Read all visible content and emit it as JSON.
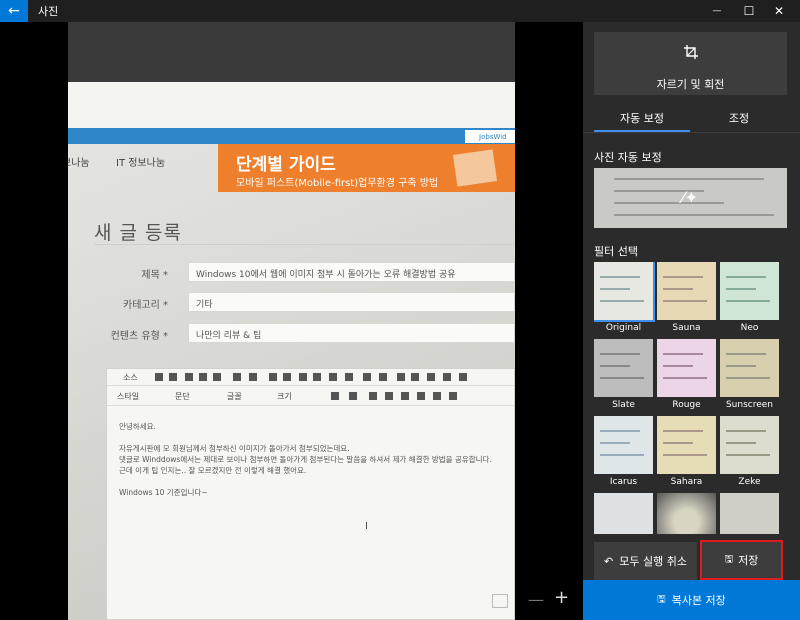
{
  "window": {
    "title": "사진",
    "back_icon": "←",
    "minimize_icon": "—",
    "maximize_icon": "☐",
    "close_icon": "✕"
  },
  "photo": {
    "nav_items": [
      "보나눔",
      "IT 정보나눔"
    ],
    "logo_text": "JobsWid",
    "banner_title": "단계별 가이드",
    "banner_subtitle": "모바일 퍼스트(Mobile-first)업무환경 구축 방법",
    "heading": "새 글 등록",
    "form": [
      {
        "label": "제목 *",
        "value": "Windows 10에서 웹에 이미지 첨부 시 돌아가는 오류 해결방법 공유"
      },
      {
        "label": "카테고리 *",
        "value": "기타"
      },
      {
        "label": "컨텐츠 유형 *",
        "value": "나만의 리뷰 & 팁"
      }
    ],
    "editor_toolbar": [
      "소스",
      "스타일",
      "문단",
      "글꼴",
      "크기"
    ],
    "editor_lines": [
      "안녕하세요.",
      "",
      "자유게시판에 모 회원님께서 첨부하신 이미지가 돌아가서 첨부되었는데요.",
      "댓글로 Winddows에서는 제대로 보이나 첨부하면 돌아가게 첨부된다는 말씀을 하셔서 제가 해결한 방법을 공유합니다.",
      "근데 이게 팁 인지는.. 잘 모르겠지만 전 이렇게 해결 했어요.",
      "",
      "Windows 10 기준입니다~"
    ],
    "cursor_glyph": "I"
  },
  "view_controls": {
    "zoom_out": "—",
    "zoom_in": "+"
  },
  "panel": {
    "crop_rotate_label": "자르기 및 회전",
    "tabs": [
      "자동 보정",
      "조정"
    ],
    "auto_enhance_title": "사진 자동 보정",
    "filter_title": "필터 선택",
    "filters": [
      {
        "name": "Original",
        "tint": "#e8e8e2"
      },
      {
        "name": "Sauna",
        "tint": "#e7d8b6"
      },
      {
        "name": "Neo",
        "tint": "#cfe6d4"
      },
      {
        "name": "Slate",
        "tint": "#bdbdbd"
      },
      {
        "name": "Rouge",
        "tint": "#ebd5e6"
      },
      {
        "name": "Sunscreen",
        "tint": "#d7cfae"
      },
      {
        "name": "Icarus",
        "tint": "#dfe6ea"
      },
      {
        "name": "Sahara",
        "tint": "#e6dcb6"
      },
      {
        "name": "Zeke",
        "tint": "#dcdccf"
      }
    ],
    "undo_all_label": "모두 실행 취소",
    "save_label": "저장",
    "save_copy_label": "복사본 저장"
  }
}
